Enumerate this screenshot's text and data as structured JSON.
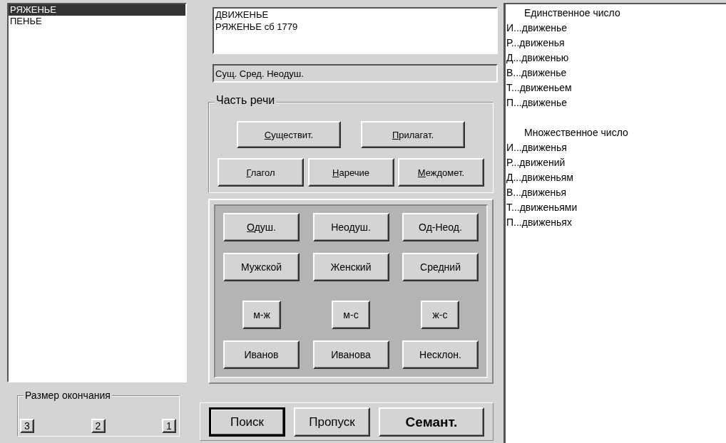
{
  "word_list": {
    "items": [
      {
        "text": "РЯЖЕНЬЕ",
        "selected": true
      },
      {
        "text": "ПЕНЬЕ",
        "selected": false
      }
    ]
  },
  "ending_size": {
    "title": "Размер окончания",
    "buttons": [
      "3",
      "2",
      "1"
    ]
  },
  "info_box": {
    "lines": [
      "ДВИЖЕНЬЕ",
      "РЯЖЕНЬЕ сб 1779"
    ]
  },
  "grammar_field": {
    "value": "Сущ. Сред. Неодуш."
  },
  "part_of_speech": {
    "title": "Часть речи",
    "rows": [
      [
        {
          "label": "Существит.",
          "underline_first": true
        },
        {
          "label": "Прилагат.",
          "underline_first": true
        }
      ],
      [
        {
          "label": "Глагол",
          "underline_first": true
        },
        {
          "label": "Наречие",
          "underline_first": true
        },
        {
          "label": "Междомет.",
          "underline_first": true
        }
      ]
    ]
  },
  "attributes": {
    "rows": [
      [
        {
          "label": "Одуш.",
          "underline_first": true,
          "kind": "wide"
        },
        {
          "label": "Неодуш.",
          "underline_first": false,
          "kind": "wide"
        },
        {
          "label": "Од-Неод.",
          "underline_first": false,
          "kind": "wide"
        }
      ],
      [
        {
          "label": "Мужской",
          "underline_first": false,
          "kind": "wide"
        },
        {
          "label": "Женский",
          "underline_first": false,
          "kind": "wide"
        },
        {
          "label": "Средний",
          "underline_first": false,
          "kind": "wide"
        }
      ],
      [
        {
          "label": "м-ж",
          "underline_first": false,
          "kind": "small"
        },
        {
          "label": "м-с",
          "underline_first": false,
          "kind": "small"
        },
        {
          "label": "ж-с",
          "underline_first": false,
          "kind": "small"
        }
      ],
      [
        {
          "label": "Иванов",
          "underline_first": false,
          "kind": "wide"
        },
        {
          "label": "Иванова",
          "underline_first": false,
          "kind": "wide"
        },
        {
          "label": "Несклон.",
          "underline_first": false,
          "kind": "wide"
        }
      ]
    ]
  },
  "actions": [
    {
      "label": "Поиск",
      "default": true,
      "bold": false
    },
    {
      "label": "Пропуск",
      "default": false,
      "bold": false
    },
    {
      "label": "Семант.",
      "default": false,
      "bold": true
    }
  ],
  "declension": {
    "sections": [
      {
        "title": "Единственное число",
        "forms": [
          "И...движенье",
          "Р...движенья",
          "Д...движенью",
          "В...движенье",
          "Т...движеньем",
          "П...движенье"
        ]
      },
      {
        "title": "Множественное число",
        "forms": [
          "И...движенья",
          "Р...движений",
          "Д...движеньям",
          "В...движенья",
          "Т...движеньями",
          "П...движеньях"
        ]
      }
    ]
  }
}
